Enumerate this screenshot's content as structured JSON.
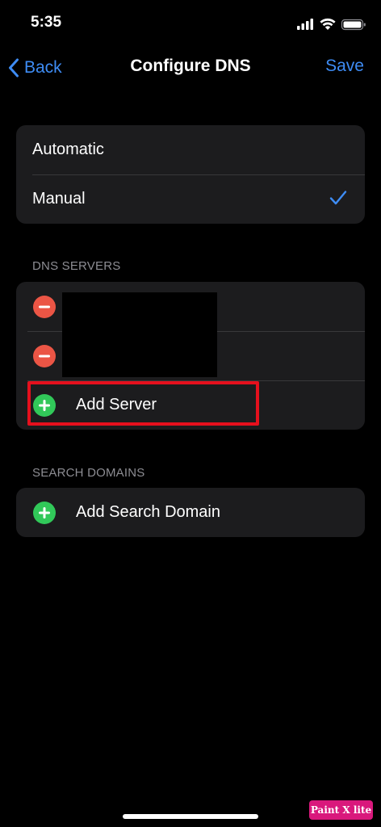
{
  "status_bar": {
    "time": "5:35",
    "icons": [
      "cellular-signal-icon",
      "wifi-icon",
      "battery-icon"
    ]
  },
  "nav": {
    "back_label": "Back",
    "title": "Configure DNS",
    "save_label": "Save",
    "accent_color": "#3e8cf4"
  },
  "mode_options": [
    {
      "label": "Automatic",
      "selected": false
    },
    {
      "label": "Manual",
      "selected": true
    }
  ],
  "dns_servers": {
    "header": "DNS SERVERS",
    "entries": [
      {
        "value": "",
        "action_icon": "remove-icon"
      },
      {
        "value": "",
        "action_icon": "remove-icon"
      }
    ],
    "add_label": "Add Server"
  },
  "search_domains": {
    "header": "SEARCH DOMAINS",
    "add_label": "Add Search Domain"
  },
  "colors": {
    "remove": "#eb5545",
    "add": "#31c859",
    "highlight": "#e5101d"
  },
  "watermark": "Paint X lite"
}
